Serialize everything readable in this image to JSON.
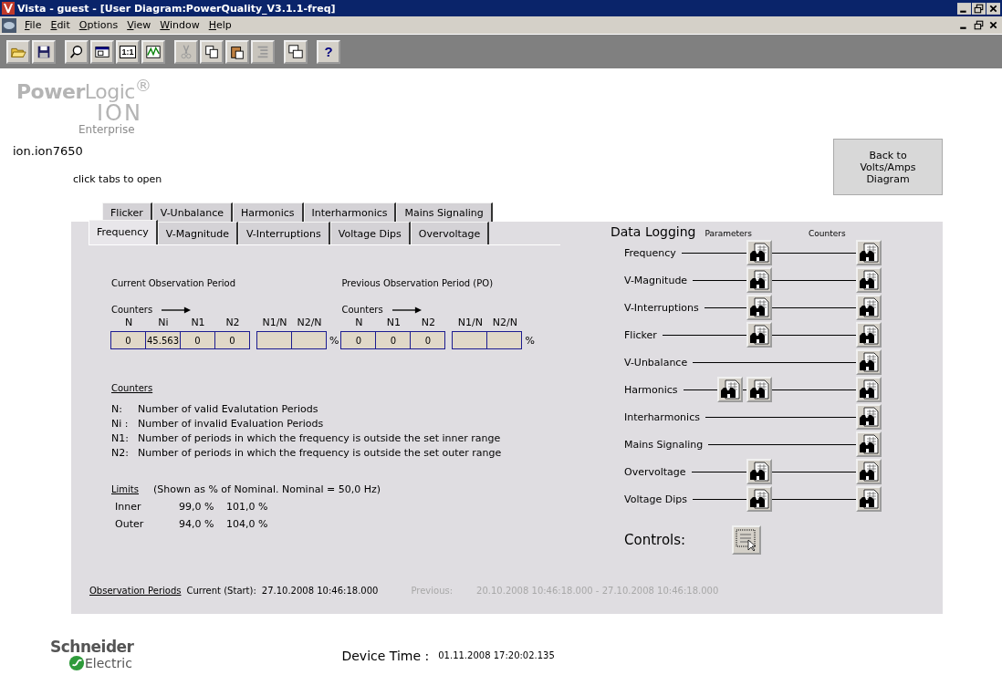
{
  "window": {
    "title": "Vista - guest - [User Diagram:PowerQuality_V3.1.1-freq]"
  },
  "menu": [
    {
      "label": "File"
    },
    {
      "label": "Edit"
    },
    {
      "label": "Options"
    },
    {
      "label": "View"
    },
    {
      "label": "Window"
    },
    {
      "label": "Help"
    }
  ],
  "toolbar": [
    [
      {
        "kind": "open",
        "disabled": false
      },
      {
        "kind": "save",
        "disabled": false
      }
    ],
    [
      {
        "kind": "find",
        "disabled": false
      },
      {
        "kind": "fit",
        "disabled": false
      },
      {
        "kind": "actual",
        "label": "1:1",
        "disabled": false
      },
      {
        "kind": "chart",
        "disabled": false
      }
    ],
    [
      {
        "kind": "cut",
        "disabled": true
      },
      {
        "kind": "copy",
        "disabled": false
      },
      {
        "kind": "paste",
        "disabled": false
      },
      {
        "kind": "list",
        "disabled": true
      }
    ],
    [
      {
        "kind": "windows",
        "disabled": false
      }
    ],
    [
      {
        "kind": "help",
        "label": "?",
        "disabled": false
      }
    ]
  ],
  "logo": {
    "line_1": "**Power**Logic$^{®}$",
    "line_2": "ION",
    "line_3": "Enterprise"
  },
  "device_name": "ion.ion7650",
  "hint": "click tabs to open",
  "back_button": "Back to Volts/Amps Diagram",
  "tabs": {
    "rows": [
      [
        {
          "label": "Flicker",
          "selected": false
        },
        {
          "label": "V-Unbalance",
          "selected": false
        },
        {
          "label": "Harmonics",
          "selected": false
        },
        {
          "label": "Interharmonics",
          "selected": false
        },
        {
          "label": "Mains Signaling",
          "selected": false
        }
      ],
      [
        {
          "label": "Frequency",
          "selected": true
        },
        {
          "label": "V-Magnitude",
          "selected": false
        },
        {
          "label": "V-Interruptions",
          "selected": false
        },
        {
          "label": "Voltage Dips",
          "selected": false
        },
        {
          "label": "Overvoltage",
          "selected": false
        }
      ]
    ]
  },
  "periods": [
    {
      "title": "Current Observation Period",
      "counters_label": "Counters",
      "groups": [
        {
          "cells": [
            {
              "header": "N",
              "value": "0"
            },
            {
              "header": "Ni",
              "value": "45.563"
            },
            {
              "header": "N1",
              "value": "0"
            },
            {
              "header": "N2",
              "value": "0"
            }
          ]
        },
        {
          "cells": [
            {
              "header": "N1/N"
            },
            {
              "header": "N2/N"
            }
          ],
          "unit": "%"
        }
      ]
    },
    {
      "title": "Previous Observation Period (PO)",
      "counters_label": "Counters",
      "groups": [
        {
          "cells": [
            {
              "header": "N",
              "value": "0"
            },
            {
              "header": "N1",
              "value": "0"
            },
            {
              "header": "N2",
              "value": "0"
            }
          ]
        },
        {
          "cells": [
            {
              "header": "N1/N"
            },
            {
              "header": "N2/N"
            }
          ],
          "unit": "%"
        }
      ]
    }
  ],
  "counters_legend": {
    "title": "Counters",
    "items": [
      {
        "key": "N:",
        "text": "Number of valid Evalutation Periods"
      },
      {
        "key": "Ni :",
        "text": "Number of invalid Evaluation Periods"
      },
      {
        "key": "N1:",
        "text": "Number of periods in which the frequency is outside the set inner range"
      },
      {
        "key": "N2:",
        "text": "Number of periods in which the frequency is outside the set outer range"
      }
    ]
  },
  "limits": {
    "title": "Limits",
    "note": "(Shown as % of Nominal. Nominal = 50,0 Hz)",
    "rows": [
      {
        "label": "Inner",
        "low": "99,0 %",
        "high": "101,0 %"
      },
      {
        "label": "Outer",
        "low": "94,0 %",
        "high": "104,0 %"
      }
    ]
  },
  "observation_periods": {
    "title": "Observation Periods",
    "current_label": "Current (Start):",
    "current_value": "27.10.2008 10:46:18.000",
    "previous_label": "Previous:",
    "previous_value": "20.10.2008 10:46:18.000 - 27.10.2008 10:46:18.000"
  },
  "data_logging": {
    "title": "Data Logging",
    "parameters_heading": "Parameters",
    "counters_heading": "Counters",
    "rows": [
      {
        "label": "Frequency",
        "parameters": [
          {
            "kind": "viewer"
          }
        ],
        "counter": {
          "kind": "viewer"
        }
      },
      {
        "label": "V-Magnitude",
        "parameters": [
          {
            "kind": "viewer"
          }
        ],
        "counter": {
          "kind": "viewer"
        }
      },
      {
        "label": "V-Interruptions",
        "parameters": [
          {
            "kind": "viewer"
          }
        ],
        "counter": {
          "kind": "viewer"
        }
      },
      {
        "label": "Flicker",
        "parameters": [
          {
            "kind": "viewer"
          }
        ],
        "counter": {
          "kind": "viewer"
        }
      },
      {
        "label": "V-Unbalance",
        "counter": {
          "kind": "viewer"
        }
      },
      {
        "label": "Harmonics",
        "parameters": [
          {
            "kind": "viewer"
          },
          {
            "kind": "viewer"
          }
        ],
        "counter": {
          "kind": "viewer"
        }
      },
      {
        "label": "Interharmonics",
        "counter": {
          "kind": "viewer"
        }
      },
      {
        "label": "Mains Signaling",
        "counter": {
          "kind": "viewer"
        }
      },
      {
        "label": "Overvoltage",
        "parameters": [
          {
            "kind": "viewer"
          }
        ],
        "counter": {
          "kind": "viewer"
        }
      },
      {
        "label": "Voltage Dips",
        "parameters": [
          {
            "kind": "viewer"
          }
        ],
        "counter": {
          "kind": "viewer"
        }
      }
    ]
  },
  "controls": {
    "label": "Controls:",
    "button": {
      "kind": "controls"
    }
  },
  "footer": {
    "brand_line_1": "Schneider",
    "brand_line_2": "Electric",
    "device_time_label": "Device Time :",
    "device_time_value": "01.11.2008 17:20:02.135"
  }
}
